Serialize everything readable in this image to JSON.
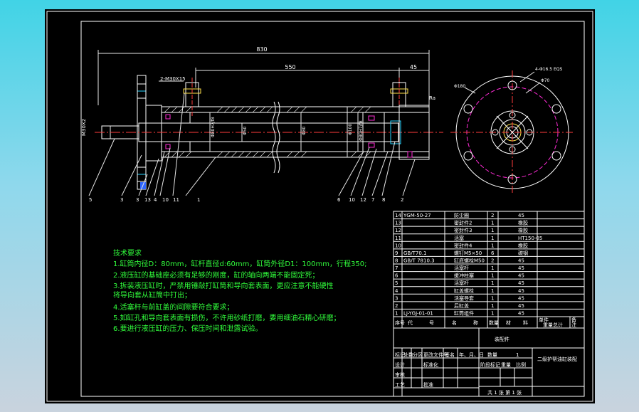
{
  "dimensions": {
    "overall": "830",
    "between_ports": "550",
    "port_offset": "45",
    "port_thread": "2-M30X15",
    "rod_end": "M30X2",
    "flange_left": "Φ80H7/f8",
    "rod_dia": "Φ50",
    "bore": "Φ80",
    "tube_od": "Φ100",
    "bore_right": "Φ80H7/f8",
    "roughness": "Ra",
    "bolt_holes": "4-Φ16.5 EQS",
    "pcd": "Φ180",
    "inner": "Φ70"
  },
  "balloons": [
    "5",
    "3",
    "3",
    "13",
    "4",
    "10",
    "11",
    "1",
    "6",
    "10",
    "12",
    "7",
    "8",
    "2"
  ],
  "tech": {
    "title": "技术要求",
    "items": [
      "1.缸筒内径D：80mm，缸杆直径d:60mm，缸筒外径D1：100mm，行程350;",
      "2.液压缸的基础座必须有足够的刚度，缸的轴向两端不能固定死；",
      "3.拆装液压缸时，严禁用锤敲打缸筒和导向套表面，更应注意不能硬性",
      "将导向套从缸筒中打出；",
      "4.活塞杆与前缸盖的间隙要符合要求；",
      "5.如缸孔和导向套表面有损伤，不许用砂纸打磨，要用细油石精心研磨；",
      "6.要进行液压缸的压力、保压时间和泄露试验。"
    ]
  },
  "bom": [
    [
      "14",
      "YGM-50-27",
      "防尘圈",
      "2",
      "45"
    ],
    [
      "13",
      "",
      "密封件2",
      "1",
      "橡胶"
    ],
    [
      "12",
      "",
      "密封件3",
      "1",
      "橡胶"
    ],
    [
      "11",
      "",
      "活塞",
      "1",
      "HT150-05"
    ],
    [
      "10",
      "",
      "密封件4",
      "1",
      "橡胶"
    ],
    [
      "9",
      "GB/T70.1",
      "螺钉M5×50",
      "6",
      "碳钢"
    ],
    [
      "8",
      "GB/T 7810.3",
      "缸底螺栓M50",
      "2",
      "45"
    ],
    [
      "7",
      "",
      "活塞杆",
      "1",
      "45"
    ],
    [
      "6",
      "",
      "缓冲柱塞",
      "1",
      "45"
    ],
    [
      "5",
      "",
      "活塞杆",
      "1",
      "45"
    ],
    [
      "4",
      "",
      "缸盖螺栓",
      "1",
      "45"
    ],
    [
      "3",
      "",
      "活塞导套",
      "1",
      "45"
    ],
    [
      "2",
      "",
      "后缸盖",
      "1",
      "45"
    ],
    [
      "1",
      "LJ-YGJ-01-01",
      "缸筒组件",
      "1",
      "45"
    ]
  ],
  "bom_header": [
    "序号",
    "代",
    "号",
    "名",
    "称",
    "数量",
    "材",
    "料",
    "单件",
    "总计",
    "备",
    "注"
  ],
  "bom_mass": "重量",
  "title_block": {
    "assembly": "装配件",
    "name": "二级护帮油缸装配",
    "qty_label": "数量",
    "qty_value": "1",
    "weight_label": "重量",
    "scale_label": "比例",
    "sheet": "共 1 张 第 1 张",
    "row_labels": [
      "标记",
      "处数",
      "分区",
      "更改文件号",
      "签名",
      "年、月、日"
    ],
    "sign_labels": [
      "设计",
      "",
      "标准化",
      "",
      "阶段标记"
    ],
    "audit": "审核",
    "process": "工艺",
    "approve": "批准"
  }
}
